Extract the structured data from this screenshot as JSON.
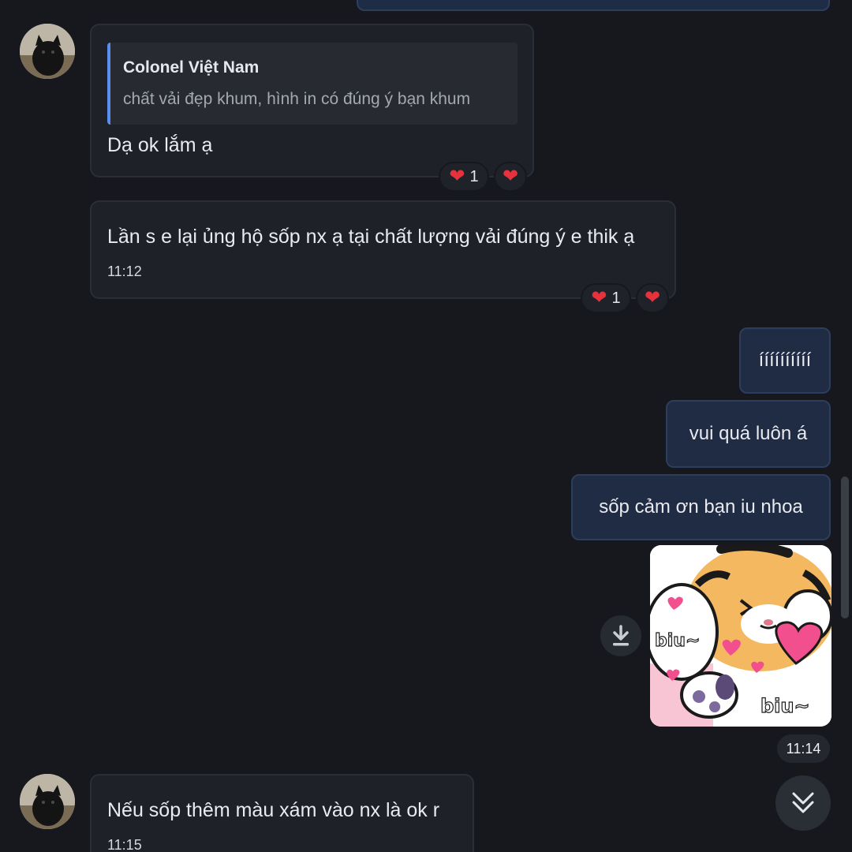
{
  "messages": {
    "m1": {
      "quote_author": "Colonel Việt Nam",
      "quote_text": "chất vải đẹp khum, hình in có đúng ý bạn khum",
      "text": "Dạ ok lắm ạ",
      "reaction_count": "1"
    },
    "m2": {
      "text": "Lần s e lại ủng hộ sốp nx ạ tại chất lượng vải đúng ý e thik ạ",
      "time": "11:12",
      "reaction_count": "1"
    },
    "out1": {
      "text": "íííííííííí"
    },
    "out2": {
      "text": "vui quá luôn á"
    },
    "out3": {
      "text": "sốp cảm ơn bạn iu nhoa"
    },
    "sticker": {
      "text_left": "biu~",
      "text_right": "biu~",
      "time": "11:14"
    },
    "m3": {
      "text": "Nếu sốp thêm màu xám vào nx là ok r",
      "time": "11:15"
    }
  },
  "icons": {
    "reaction": "red-heart-icon",
    "download": "download-icon",
    "scroll_down": "double-chevron-down-icon"
  },
  "colors": {
    "background": "#16181d",
    "incoming_bubble": "#1e2127",
    "outgoing_bubble": "#1f2c44",
    "quote_bar": "#5b8def",
    "heart": "#e5323c"
  }
}
